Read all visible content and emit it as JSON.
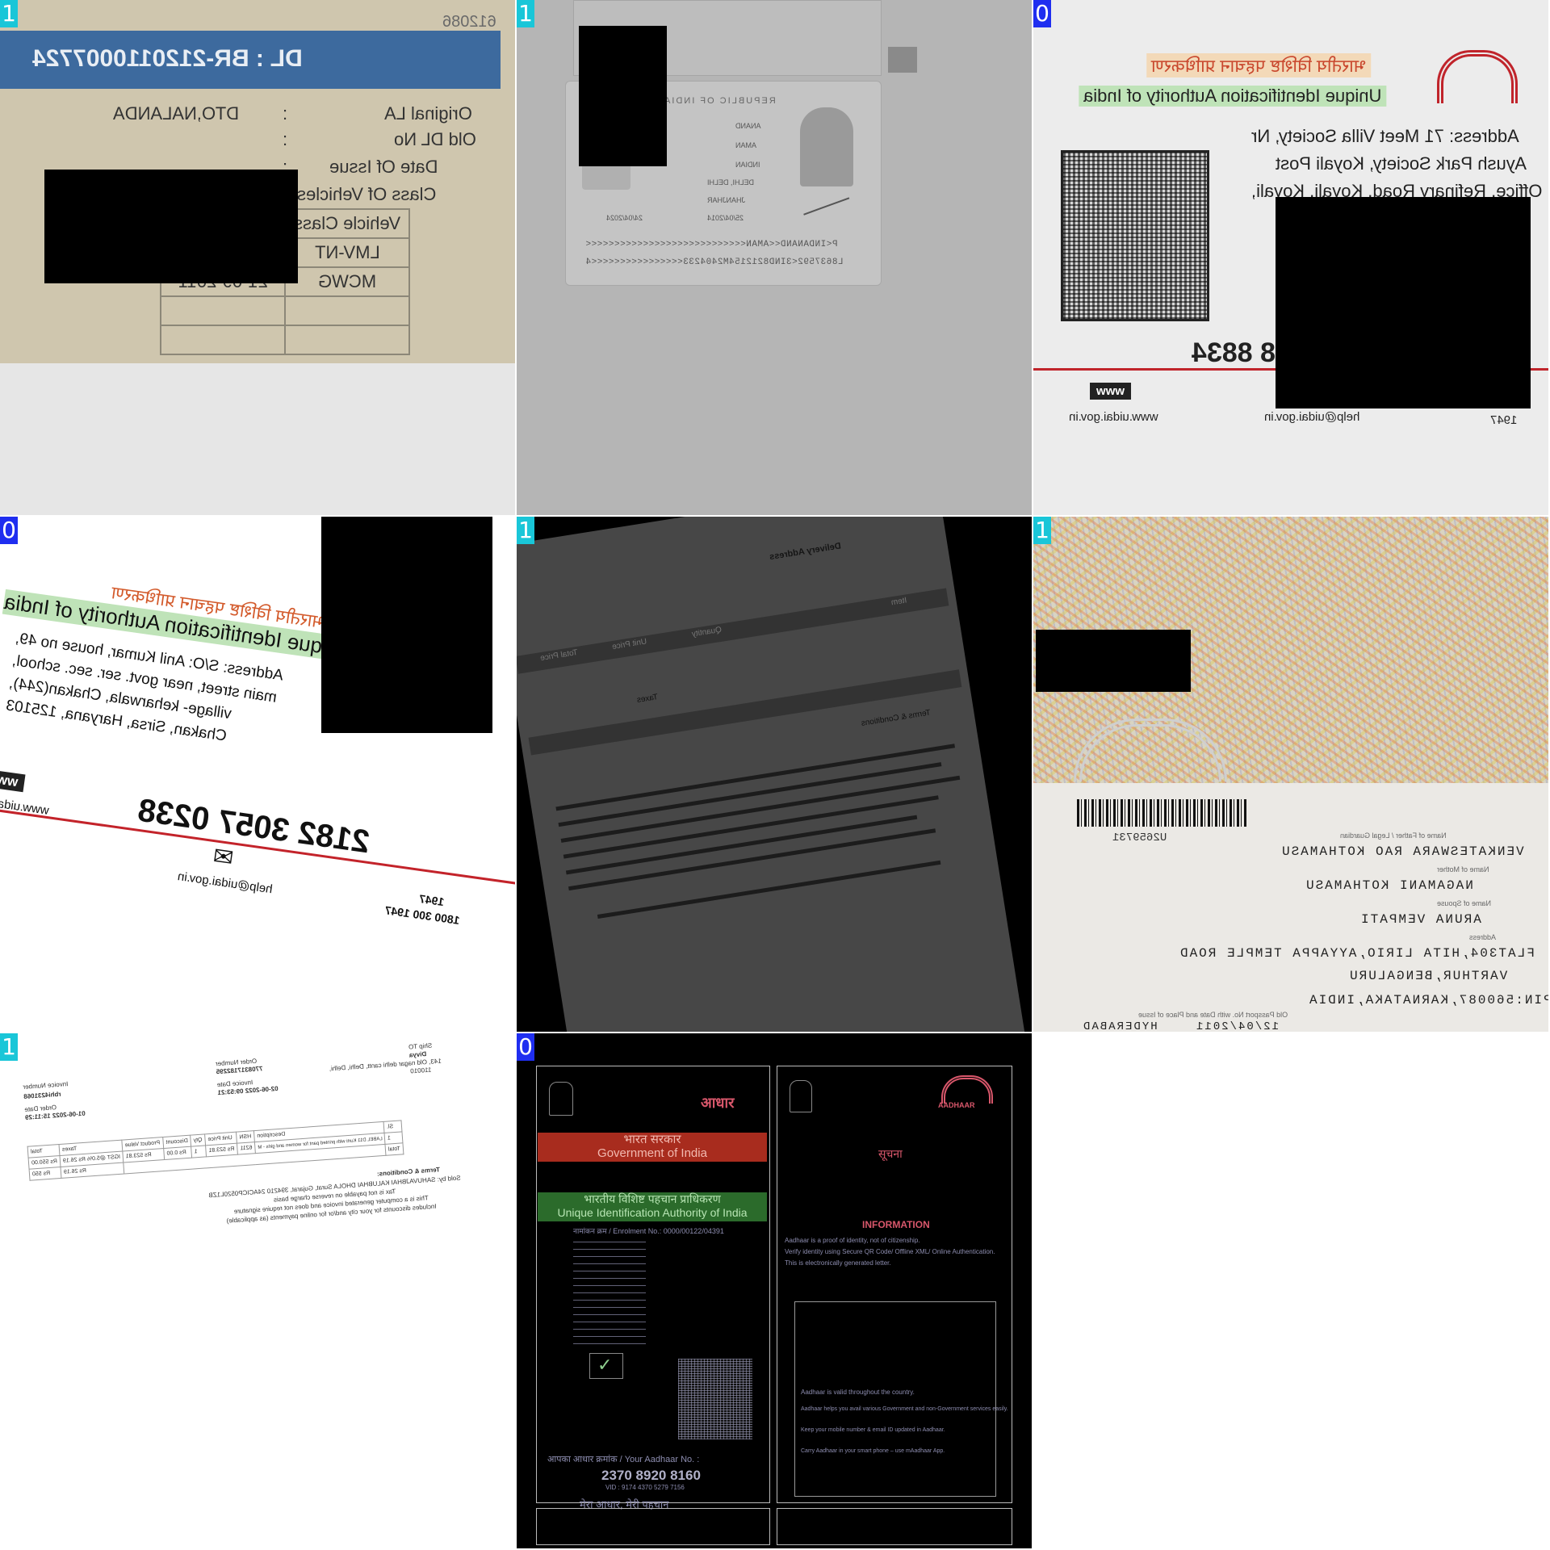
{
  "badges": [
    "1",
    "1",
    "0",
    "0",
    "1",
    "1",
    "1",
    "0"
  ],
  "colors": {
    "cyan_badge": "#19c6d8",
    "blue_badge": "#1f2ef0",
    "redaction": "#000000"
  },
  "tile1": {
    "serial": "612086",
    "dl_number": "DL : BR-2120110007724",
    "rows": [
      {
        "label": "Original LA",
        "sep": ":",
        "value": "DTO,NALANDA"
      },
      {
        "label": "Old DL No",
        "sep": ":",
        "value": ""
      },
      {
        "label": "Date Of Issue",
        "sep": ":",
        "value": ""
      },
      {
        "label": "Class Of Vehicles",
        "sep": "",
        "value": ""
      }
    ],
    "table_header": "Vehicle Class",
    "vehicle_classes": [
      "LMV-NT",
      "MCWG"
    ],
    "validity": "21-09-2011"
  },
  "tile2": {
    "mrz_line1": "P<INDANAND<<AMAN<<<<<<<<<<<<<<<<<<<<<<<<<<<<",
    "mrz_line2": "L8637592<3IND8212154M2404233<<<<<<<<<<<<<<<<4",
    "labels": [
      "REPUBLIC OF INDIA",
      "ANAND",
      "AMAN",
      "INDIAN",
      "DELHI, DELHI",
      "JHANJHAR",
      "25/04/2014",
      "24/04/2024"
    ]
  },
  "tile3": {
    "hindi": "भारतीय विशिष्ट पहचान प्राधिकरण",
    "english": "Unique Identification Authority of India",
    "address": [
      "Address: 71 Meet Villa Society, Nr",
      "Ayush Park Society, Koyali Post",
      "Office, Refinary Road, Koyali, Koyali,"
    ],
    "number": "8 8834",
    "www": "www",
    "site": "www.uidai.gov.in",
    "help": "help@uidai.gov.in",
    "phone": "1947"
  },
  "tile4": {
    "hindi": "भारतीय विशिष्ट पहचान प्राधिकरण",
    "english": "Unique Identification Authority of India",
    "address": [
      "Address: S/O: Anil Kumar, house no 49,",
      "main street, near govt. ser. sec. school,",
      "village- keharwala, Chakan(244),",
      "Chakan, Sirsa, Haryana, 125103"
    ],
    "number": "2182 3057 0238",
    "www": "www",
    "site": "www.uidai.gov.in",
    "help": "help@uidai.gov.in",
    "phone": "1947",
    "phone2": "1800 300 1947"
  },
  "tile5": {
    "labels": [
      "Delivery Address",
      "Item",
      "Quantity",
      "Unit Price",
      "Total Price",
      "Taxes",
      "Terms & Conditions"
    ]
  },
  "tile6": {
    "barcode_id": "U2659731",
    "fields": [
      "VENKATESWARA RAO KOTHAMASU",
      "NAGAMANI KOTHAMASU",
      "ARUNA VEMPATI",
      "FLAT304,HITA LIRIO,AYYAPPA TEMPLE ROAD",
      "VARTHUR,BENGALURU",
      "PIN:560087,KARNATAKA,INDIA",
      "HYDERABAD"
    ],
    "captions": [
      "Name of Father / Legal Guardian",
      "Name of Mother",
      "Name of Spouse",
      "Address",
      "Old Passport No. with Date and Place of Issue"
    ],
    "date": "12/04/2011"
  },
  "tile7": {
    "invoice_number_label": "Invoice Number",
    "invoice_number": "rbhi4231068",
    "order_label": "Order Date",
    "order_date": "01-06-2022 15:11:29",
    "order_number_label": "Order Number",
    "order_number": "7708317182295",
    "invoice_date_label": "Invoice Date",
    "invoice_date": "02-06-2022 09:53:21",
    "ship_to": "Ship TO",
    "ship_name": "Divya",
    "ship_addr": "143, Old nagar delhi cantt, Delhi, Delhi,",
    "ship_pin": "110010",
    "headers": [
      "Sl.",
      "Description",
      "HSN",
      "Unit Price",
      "Qty",
      "Discount",
      "Product Value",
      "Taxes",
      "Total"
    ],
    "row": [
      "1",
      "LABEL D11 Kurti with printed pant for women and girls - M",
      "6211",
      "Rs 523.81",
      "1",
      "Rs 0.00",
      "Rs 523.81",
      "IGST @5.0% Rs 26.19",
      "Rs 550.00"
    ],
    "total_row": [
      "Total",
      "Rs 26.19",
      "Rs 550"
    ],
    "terms_title": "Terms & Conditions:",
    "terms": [
      "Sold by: SAHUVAJBHAI KALUBHAI DHOLA Surat, Gujarat, 394210 24ACICP0520L1ZB",
      "Tax is not payable on reverse charge basis",
      "This is a computer generated invoice and does not require signature",
      "Includes discounts for your city and/or for online payments (as applicable)"
    ]
  },
  "tile8": {
    "logo": "आधार",
    "gov_hi": "भारत सरकार",
    "gov_en": "Government of India",
    "uid_hi": "भारतीय विशिष्ट पहचान प्राधिकरण",
    "uid_en": "Unique Identification Authority of India",
    "enrol": "नामांकन क्रम / Enrolment No.: 0000/00122/04391",
    "aadhaar_label": "आपका आधार क्रमांक / Your Aadhaar No. :",
    "aadhaar_no": "2370 8920 8160",
    "vid": "VID : 9174 4370 5279 7156",
    "footer": "मेरा आधार, मेरी पहचान",
    "right_logo": "AADHAAR",
    "suchna": "सूचना",
    "info_title": "INFORMATION",
    "info": [
      "Aadhaar is a proof of identity, not of citizenship.",
      "Verify identity using Secure QR Code/ Offline XML/ Online Authentication.",
      "This is electronically generated letter."
    ],
    "box": [
      "Aadhaar is valid throughout the country.",
      "Aadhaar helps you avail various Government and non-Government services easily.",
      "Keep your mobile number & email ID updated in Aadhaar.",
      "Carry Aadhaar in your smart phone – use mAadhaar App."
    ]
  }
}
